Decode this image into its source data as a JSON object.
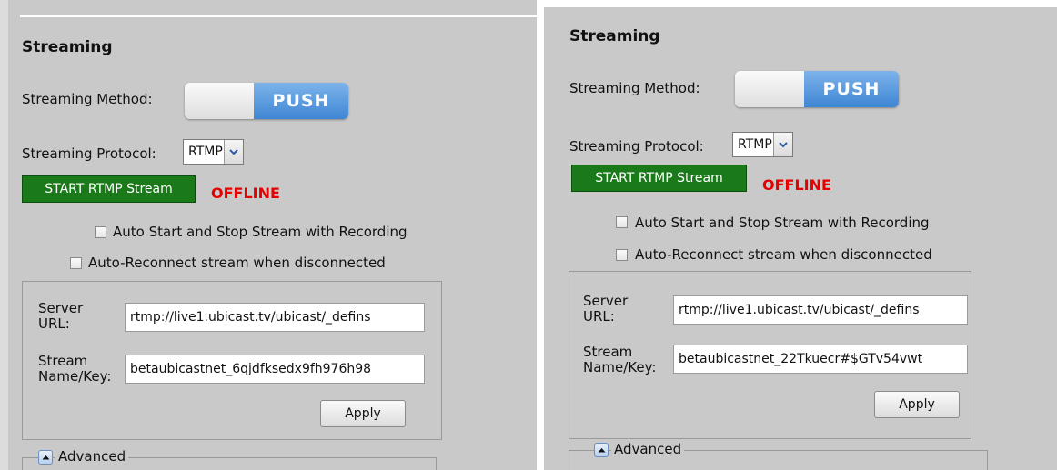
{
  "panels": [
    {
      "section_title": "Streaming",
      "streaming_method_label": "Streaming Method:",
      "toggle_value": "PUSH",
      "streaming_protocol_label": "Streaming Protocol:",
      "protocol_value": "RTMP",
      "start_button_label": "START RTMP Stream",
      "status": "OFFLINE",
      "auto_start_label": "Auto Start and Stop Stream with Recording",
      "auto_reconnect_label": "Auto-Reconnect stream when disconnected",
      "server_url_label": "Server URL:",
      "server_url_value": "rtmp://live1.ubicast.tv/ubicast/_defins",
      "stream_key_label": "Stream Name/Key:",
      "stream_key_value": "betaubicastnet_6qjdfksedx9fh976h98",
      "apply_label": "Apply",
      "advanced_label": "Advanced"
    },
    {
      "section_title": "Streaming",
      "streaming_method_label": "Streaming Method:",
      "toggle_value": "PUSH",
      "streaming_protocol_label": "Streaming Protocol:",
      "protocol_value": "RTMP",
      "start_button_label": "START RTMP Stream",
      "status": "OFFLINE",
      "auto_start_label": "Auto Start and Stop Stream with Recording",
      "auto_reconnect_label": "Auto-Reconnect stream when disconnected",
      "server_url_label": "Server URL:",
      "server_url_value": "rtmp://live1.ubicast.tv/ubicast/_defins",
      "stream_key_label": "Stream Name/Key:",
      "stream_key_value": "betaubicastnet_22Tkuecr#$GTv54vwt",
      "apply_label": "Apply",
      "advanced_label": "Advanced"
    }
  ],
  "colors": {
    "panel_bg": "#c9c9c9",
    "start_button": "#1a7a1a",
    "offline": "#e60000",
    "push_toggle": "#3f86d4"
  },
  "icons": {
    "protocol_dropdown": "chevron-down-icon",
    "advanced_toggle": "chevron-up-icon"
  }
}
